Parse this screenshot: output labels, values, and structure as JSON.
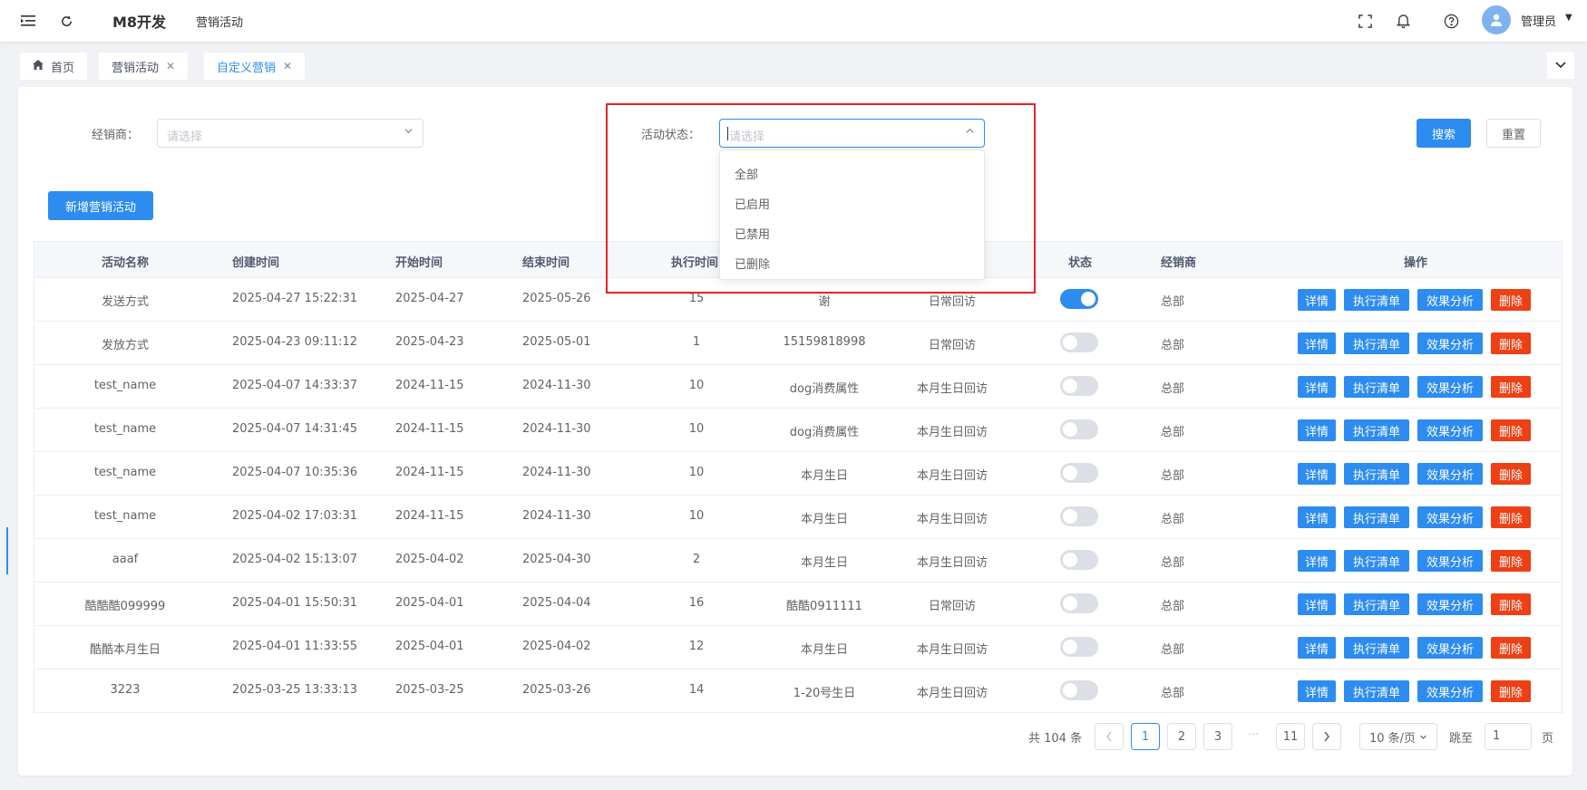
{
  "header": {
    "title": "M8开发",
    "breadcrumb": "营销活动",
    "user": "管理员"
  },
  "tabs": [
    {
      "label": "首页"
    },
    {
      "label": "营销活动"
    },
    {
      "label": "自定义营销"
    }
  ],
  "filters": {
    "dealer_label": "经销商：",
    "dealer_placeholder": "请选择",
    "status_label": "活动状态：",
    "status_placeholder": "请选择",
    "search_label": "搜索",
    "reset_label": "重置"
  },
  "add_button_label": "新增营销活动",
  "status_dropdown": {
    "options": [
      "全部",
      "已启用",
      "已禁用",
      "已删除"
    ]
  },
  "table": {
    "columns": [
      "活动名称",
      "创建时间",
      "开始时间",
      "结束时间",
      "执行时间",
      "状态",
      "经销商",
      "操作"
    ],
    "actions": {
      "detail": "详情",
      "list": "执行清单",
      "analysis": "效果分析",
      "delete": "删除"
    },
    "rows": [
      {
        "name": "发送方式",
        "created": "2025-04-27 15:22:31",
        "start": "2025-04-27",
        "end": "2025-05-26",
        "exec": "15",
        "target": "谢",
        "type": "日常回访",
        "enabled": true,
        "dealer": "总部"
      },
      {
        "name": "发放方式",
        "created": "2025-04-23 09:11:12",
        "start": "2025-04-23",
        "end": "2025-05-01",
        "exec": "1",
        "target": "15159818998",
        "type": "日常回访",
        "enabled": false,
        "dealer": "总部"
      },
      {
        "name": "test_name",
        "created": "2025-04-07 14:33:37",
        "start": "2024-11-15",
        "end": "2024-11-30",
        "exec": "10",
        "target": "dog消费属性",
        "type": "本月生日回访",
        "enabled": false,
        "dealer": "总部"
      },
      {
        "name": "test_name",
        "created": "2025-04-07 14:31:45",
        "start": "2024-11-15",
        "end": "2024-11-30",
        "exec": "10",
        "target": "dog消费属性",
        "type": "本月生日回访",
        "enabled": false,
        "dealer": "总部"
      },
      {
        "name": "test_name",
        "created": "2025-04-07 10:35:36",
        "start": "2024-11-15",
        "end": "2024-11-30",
        "exec": "10",
        "target": "本月生日",
        "type": "本月生日回访",
        "enabled": false,
        "dealer": "总部"
      },
      {
        "name": "test_name",
        "created": "2025-04-02 17:03:31",
        "start": "2024-11-15",
        "end": "2024-11-30",
        "exec": "10",
        "target": "本月生日",
        "type": "本月生日回访",
        "enabled": false,
        "dealer": "总部"
      },
      {
        "name": "aaaf",
        "created": "2025-04-02 15:13:07",
        "start": "2025-04-02",
        "end": "2025-04-30",
        "exec": "2",
        "target": "本月生日",
        "type": "本月生日回访",
        "enabled": false,
        "dealer": "总部"
      },
      {
        "name": "酷酷酷099999",
        "created": "2025-04-01 15:50:31",
        "start": "2025-04-01",
        "end": "2025-04-04",
        "exec": "16",
        "target": "酷酷0911111",
        "type": "日常回访",
        "enabled": false,
        "dealer": "总部"
      },
      {
        "name": "酷酷本月生日",
        "created": "2025-04-01 11:33:55",
        "start": "2025-04-01",
        "end": "2025-04-02",
        "exec": "12",
        "target": "本月生日",
        "type": "本月生日回访",
        "enabled": false,
        "dealer": "总部"
      },
      {
        "name": "3223",
        "created": "2025-03-25 13:33:13",
        "start": "2025-03-25",
        "end": "2025-03-26",
        "exec": "14",
        "target": "1-20号生日",
        "type": "本月生日回访",
        "enabled": false,
        "dealer": "总部"
      }
    ]
  },
  "pagination": {
    "total": "共 104 条",
    "pages": [
      "1",
      "2",
      "3",
      "11"
    ],
    "ellipsis": "···",
    "current": "1",
    "page_size": "10 条/页",
    "jump_label": "跳至",
    "jump_value": "1",
    "page_suffix": "页"
  },
  "colors": {
    "primary": "#2d8cf0",
    "danger": "#ed4014",
    "highlight": "#e5242a"
  }
}
